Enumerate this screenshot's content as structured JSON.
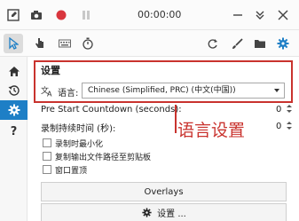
{
  "titlebar": {
    "timer": "00:00:00",
    "icons": [
      "pencil-icon",
      "camera-icon",
      "record-icon",
      "pause-icon",
      "minimize-icon",
      "collapse-icon",
      "close-icon"
    ]
  },
  "toolbar": {
    "tools": [
      "pointer-tool-icon",
      "hand-tool-icon",
      "keyboard-icon",
      "stopwatch-icon"
    ],
    "actions": [
      "refresh-icon",
      "brush-icon",
      "folder-icon",
      "gear-icon"
    ]
  },
  "sidebar": {
    "items": [
      "home-icon",
      "history-icon",
      "settings-icon",
      "help-icon"
    ],
    "active": "settings-icon",
    "help_glyph": "?"
  },
  "settings": {
    "section_title": "设置",
    "language_label": "语言:",
    "language_value": "Chinese (Simplified, PRC) (中文(中国))",
    "pre_start_label": "Pre Start Countdown (seconds):",
    "pre_start_value": "0",
    "duration_label": "录制持续时间 (秒):",
    "duration_value": "0",
    "checkboxes": [
      {
        "label": "录制时最小化",
        "checked": false
      },
      {
        "label": "复制输出文件路径至剪贴板",
        "checked": false
      },
      {
        "label": "窗口置顶",
        "checked": false
      }
    ],
    "overlays_button": "Overlays",
    "settings_button": "设置 ..."
  },
  "annotation": {
    "text": "语言设置",
    "color": "#c9332e"
  },
  "colors": {
    "accent": "#1e7fc6",
    "record": "#d9363e",
    "annotation": "#c9332e"
  }
}
